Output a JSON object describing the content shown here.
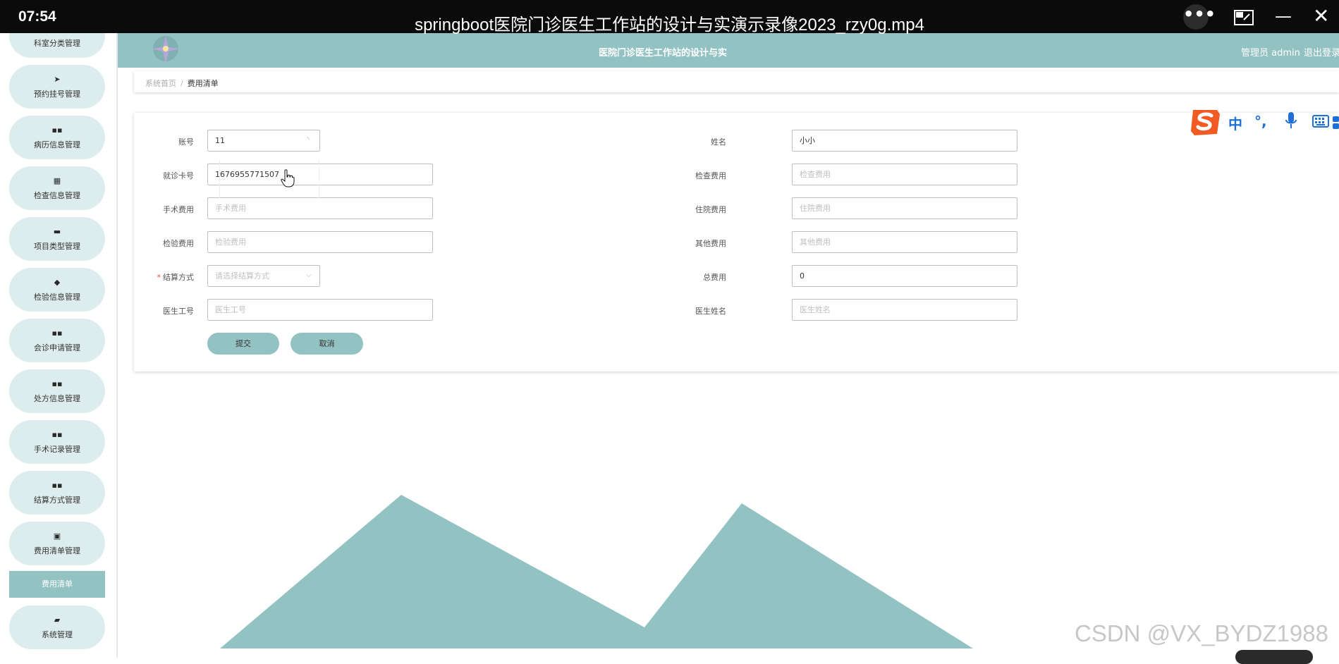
{
  "player": {
    "time": "07:54",
    "title": "springboot医院门诊医生工作站的设计与实演示录像2023_rzy0g.mp4",
    "more_glyph": "•••",
    "pip_icon": "picture-in-picture-icon",
    "minimize_glyph": "—",
    "close_glyph": "✕"
  },
  "header": {
    "title": "医院门诊医生工作站的设计与实",
    "user": "管理员 admin",
    "logout": "退出登录",
    "bg_color": "#93c2c3"
  },
  "sidebar": {
    "items": [
      {
        "label": "科室分类管理",
        "icon": "grid-icon",
        "glyph": "▪"
      },
      {
        "label": "预约挂号管理",
        "icon": "send-icon",
        "glyph": "➤"
      },
      {
        "label": "病历信息管理",
        "icon": "grid-icon",
        "glyph": "▪▪"
      },
      {
        "label": "检查信息管理",
        "icon": "grid-icon",
        "glyph": "▦"
      },
      {
        "label": "项目类型管理",
        "icon": "monitor-icon",
        "glyph": "▬"
      },
      {
        "label": "检验信息管理",
        "icon": "flask-icon",
        "glyph": "◆"
      },
      {
        "label": "会诊申请管理",
        "icon": "grid-icon",
        "glyph": "▪▪"
      },
      {
        "label": "处方信息管理",
        "icon": "grid-icon",
        "glyph": "▪▪"
      },
      {
        "label": "手术记录管理",
        "icon": "grid-icon",
        "glyph": "▪▪"
      },
      {
        "label": "结算方式管理",
        "icon": "grid-icon",
        "glyph": "▪▪"
      },
      {
        "label": "费用清单管理",
        "icon": "clipboard-icon",
        "glyph": "▣"
      },
      {
        "label": "系统管理",
        "icon": "briefcase-icon",
        "glyph": "▰"
      }
    ],
    "active_item": "费用清单",
    "pill_color": "#ddeced"
  },
  "breadcrumb": {
    "home": "系统首页",
    "separator": "/",
    "current": "费用清单"
  },
  "form": {
    "account": {
      "label": "账号",
      "value": "11"
    },
    "name": {
      "label": "姓名",
      "value": "小小"
    },
    "card_no": {
      "label": "就诊卡号",
      "value": "1676955771507"
    },
    "exam_fee": {
      "label": "检查费用",
      "placeholder": "检查费用"
    },
    "surgery_fee": {
      "label": "手术费用",
      "placeholder": "手术费用"
    },
    "hospital_fee": {
      "label": "住院费用",
      "placeholder": "住院费用"
    },
    "test_fee": {
      "label": "检验费用",
      "placeholder": "检验费用"
    },
    "other_fee": {
      "label": "其他费用",
      "placeholder": "其他费用"
    },
    "settle_method": {
      "label": "结算方式",
      "required_mark": "*",
      "placeholder": "请选择结算方式"
    },
    "total_fee": {
      "label": "总费用",
      "value": "0"
    },
    "doctor_id": {
      "label": "医生工号",
      "placeholder": "医生工号"
    },
    "doctor_name": {
      "label": "医生姓名",
      "placeholder": "医生姓名"
    },
    "submit": "提交",
    "cancel": "取消"
  },
  "ime": {
    "logo": "sogou-logo",
    "mode": "中",
    "punct": "°,",
    "mic_icon": "microphone-icon",
    "keyboard_icon": "keyboard-icon",
    "brand_color": "#1e6fd9"
  },
  "watermark": "CSDN @VX_BYDZ1988"
}
